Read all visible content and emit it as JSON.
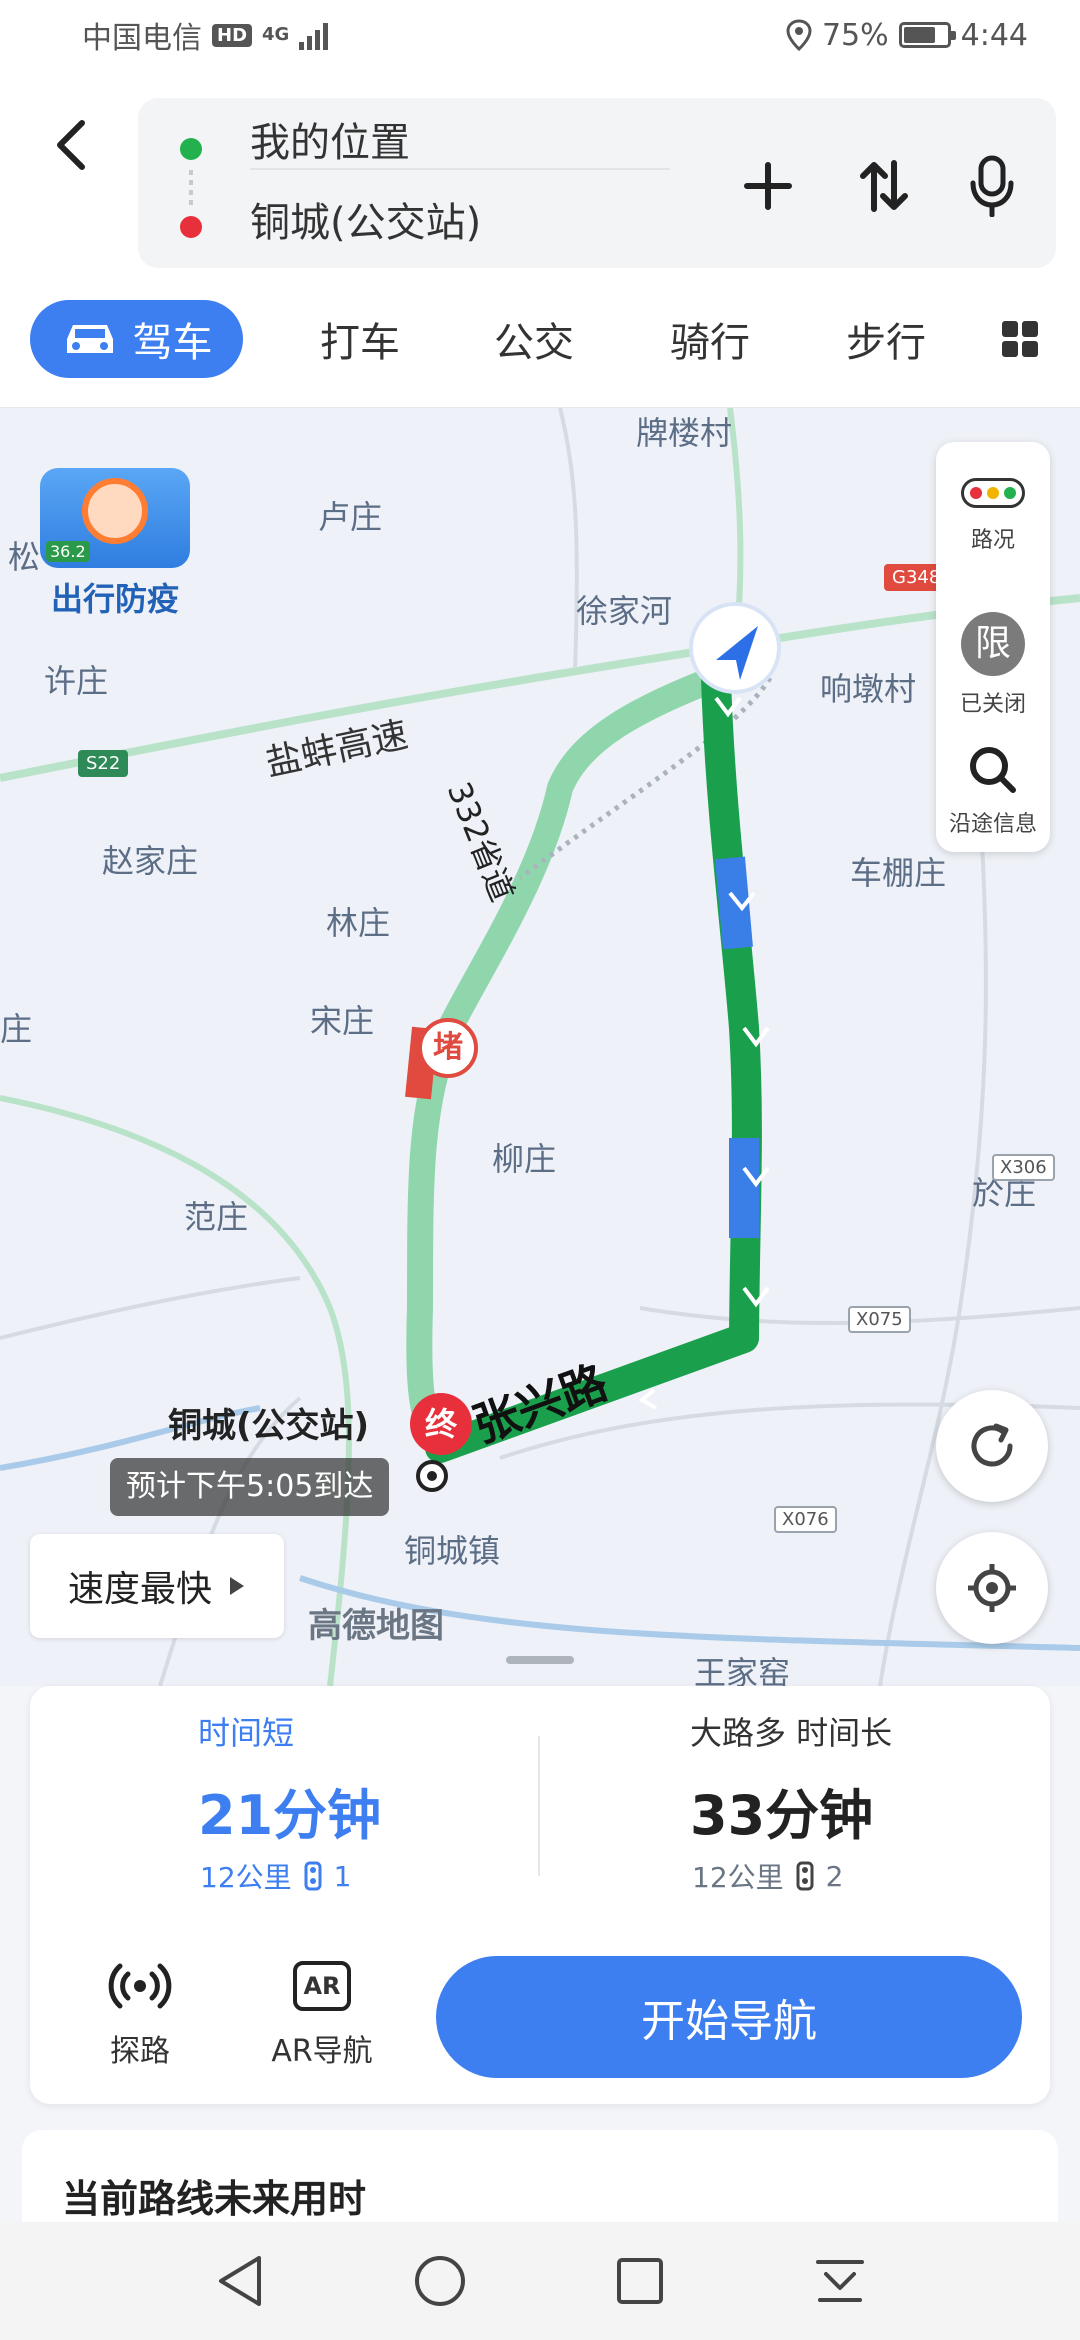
{
  "status_bar": {
    "carrier": "中国电信",
    "hd": "HD",
    "network": "4G",
    "battery_pct": "75%",
    "battery_level": 0.75,
    "time": "4:44"
  },
  "route": {
    "start": "我的位置",
    "end": "铜城(公交站)"
  },
  "tabs": [
    {
      "label": "驾车",
      "icon": "car-icon"
    },
    {
      "label": "打车"
    },
    {
      "label": "公交"
    },
    {
      "label": "骑行"
    },
    {
      "label": "步行"
    }
  ],
  "map": {
    "promo_label": "出行防疫",
    "promo_badge": "36.2",
    "places": [
      "牌楼村",
      "卢庄",
      "徐家河",
      "响墩村",
      "许庄",
      "盐蚌高速",
      "赵家庄",
      "林庄",
      "车棚庄",
      "宋庄",
      "庄",
      "柳庄",
      "范庄",
      "於庄",
      "铜城镇",
      "王家窑",
      "松"
    ],
    "road_codes": [
      "G348",
      "S22",
      "X306",
      "X075",
      "X076"
    ],
    "route_road_332": "332省道",
    "route_road_main": "张兴路",
    "jam_label": "堵",
    "end_label": "终",
    "destination": "铜城(公交站)",
    "eta": "预计下午5:05到达",
    "speed_option": "速度最快",
    "brand": "高德地图",
    "side": {
      "traffic": "路况",
      "limit_icon": "限",
      "limit": "已关闭",
      "search": "沿途信息"
    },
    "traffic_colors": {
      "smooth": "#22b14c",
      "slow": "#f0b400",
      "jam": "#e04a3f",
      "route_blue": "#3a7ee8",
      "alt_route": "#8fd6ad"
    }
  },
  "options": [
    {
      "tag": "时间短",
      "time": "21分钟",
      "distance": "12公里",
      "lights": "1",
      "selected": true
    },
    {
      "tag": "大路多 时间长",
      "time": "33分钟",
      "distance": "12公里",
      "lights": "2",
      "selected": false
    }
  ],
  "actions": {
    "explore": "探路",
    "ar": "AR导航",
    "ar_icon": "AR",
    "start": "开始导航"
  },
  "future": {
    "title": "当前路线未来用时"
  }
}
